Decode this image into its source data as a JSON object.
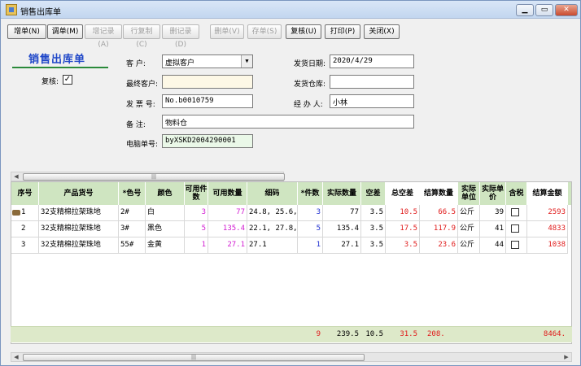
{
  "window": {
    "title": "销售出库单"
  },
  "titlebar_buttons": {
    "minimize": "▁",
    "restore": "▭",
    "close": "✕"
  },
  "toolbar": {
    "add": "增单(N)",
    "edit": "调单(M)",
    "add_record": "增记录(A)",
    "copy_row": "行复制(C)",
    "del_record": "删记录(D)",
    "del_doc": "删单(V)",
    "save": "存单(S)",
    "review": "复核(U)",
    "print": "打印(P)",
    "close": "关闭(X)"
  },
  "form": {
    "title": "销售出库单",
    "review_label": "复核:",
    "review_checked": "✓",
    "customer_label": "客    户:",
    "customer_value": "虚拟客户",
    "final_customer_label": "最终客户:",
    "final_customer_value": "",
    "invoice_label": "发 票 号:",
    "invoice_value": "No.b0010759",
    "remark_label": "备    注:",
    "remark_value": "物料仓",
    "pc_no_label": "电脑单号:",
    "pc_no_value": "byXSKD2004290001",
    "ship_date_label": "发货日期:",
    "ship_date_value": "2020/4/29",
    "warehouse_label": "发货仓库:",
    "warehouse_value": "",
    "handler_label": "经 办 人:",
    "handler_value": "小林"
  },
  "grid": {
    "headers": [
      "序号",
      "产品货号",
      "*色号",
      "颜色",
      "可用件数",
      "可用数量",
      "细码",
      "*件数",
      "实际数量",
      "空差",
      "总空差",
      "结算数量",
      "实际单位",
      "实际单价",
      "含税",
      "结算金额"
    ],
    "rows": [
      {
        "no": "1",
        "sku": "32支精棉拉架珠地",
        "color_no": "2#",
        "color": "白",
        "avail_pcs": "3",
        "avail_qty": "77",
        "detail": "24.8, 25.6,",
        "pcs": "3",
        "actual_qty": "77",
        "diff": "3.5",
        "total_diff": "10.5",
        "settle_qty": "66.5",
        "unit": "公斤",
        "price": "39",
        "amount": "2593"
      },
      {
        "no": "2",
        "sku": "32支精棉拉架珠地",
        "color_no": "3#",
        "color": "黑色",
        "avail_pcs": "5",
        "avail_qty": "135.4",
        "detail": "22.1, 27.8,",
        "pcs": "5",
        "actual_qty": "135.4",
        "diff": "3.5",
        "total_diff": "17.5",
        "settle_qty": "117.9",
        "unit": "公斤",
        "price": "41",
        "amount": "4833"
      },
      {
        "no": "3",
        "sku": "32支精棉拉架珠地",
        "color_no": "55#",
        "color": "金黄",
        "avail_pcs": "1",
        "avail_qty": "27.1",
        "detail": "27.1",
        "pcs": "1",
        "actual_qty": "27.1",
        "diff": "3.5",
        "total_diff": "3.5",
        "settle_qty": "23.6",
        "unit": "公斤",
        "price": "44",
        "amount": "1038"
      }
    ],
    "totals": {
      "pcs": "9",
      "actual_qty": "239.5",
      "diff": "10.5",
      "total_diff": "31.5",
      "settle_qty": "208.",
      "amount": "8464."
    }
  },
  "scroll": {
    "thumb_grip": "|||"
  },
  "colors": {
    "header_bg": "#cfe5c1",
    "title_blue": "#1e46c8",
    "red": "#e01a1a",
    "blue": "#1f2fd0",
    "magenta": "#d21cd2"
  }
}
